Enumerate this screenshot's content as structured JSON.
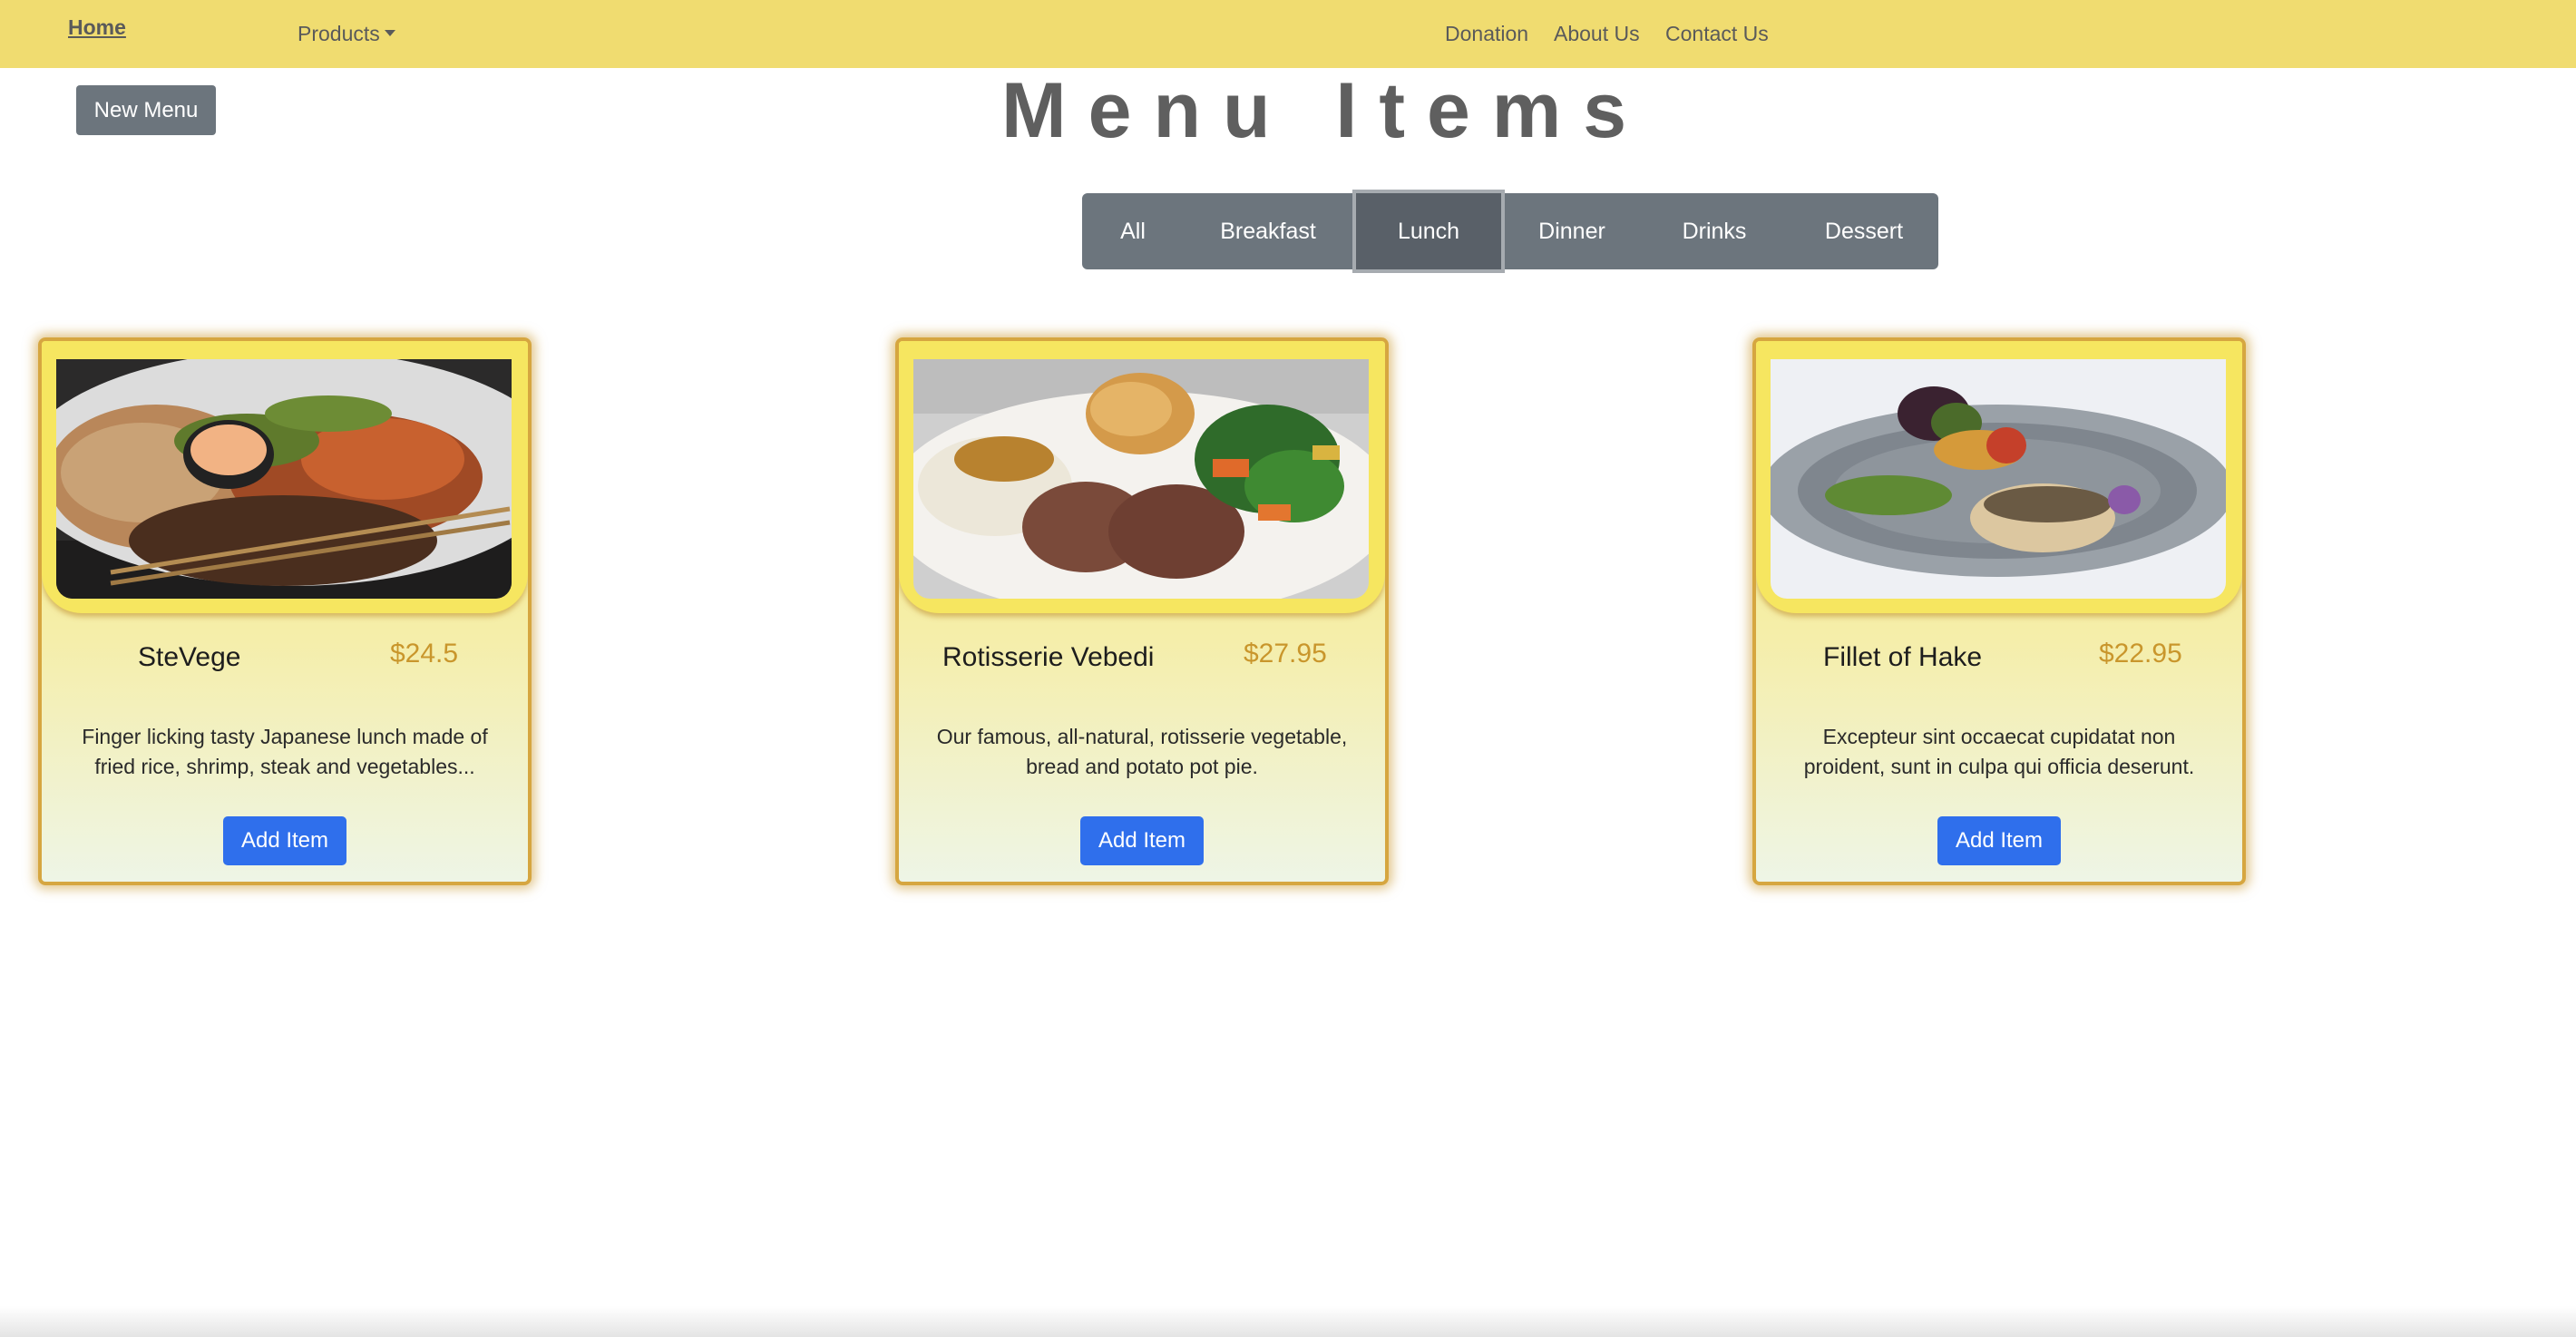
{
  "nav": {
    "home": "Home",
    "products": "Products",
    "donation": "Donation",
    "about": "About Us",
    "contact": "Contact Us"
  },
  "new_menu_label": "New Menu",
  "title": "Menu Items",
  "filters": [
    {
      "label": "All",
      "active": false
    },
    {
      "label": "Breakfast",
      "active": false
    },
    {
      "label": "Lunch",
      "active": true
    },
    {
      "label": "Dinner",
      "active": false
    },
    {
      "label": "Drinks",
      "active": false
    },
    {
      "label": "Dessert",
      "active": false
    }
  ],
  "items": [
    {
      "name": "SteVege",
      "price": "$24.5",
      "description": "Finger licking tasty Japanese lunch made of fried rice, shrimp, steak and vegetables...",
      "button": "Add Item"
    },
    {
      "name": "Rotisserie Vebedi",
      "price": "$27.95",
      "description": "Our famous, all-natural, rotisserie vegetable, bread and potato pot pie.",
      "button": "Add Item"
    },
    {
      "name": "Fillet of Hake",
      "price": "$22.95",
      "description": "Excepteur sint occaecat cupidatat non proident, sunt in culpa qui officia deserunt.",
      "button": "Add Item"
    }
  ],
  "colors": {
    "navbar": "#f0dc70",
    "button_grey": "#6c757d",
    "add_button_blue": "#2f6fec",
    "price_gold": "#c9962c",
    "card_border": "#d6a640"
  }
}
